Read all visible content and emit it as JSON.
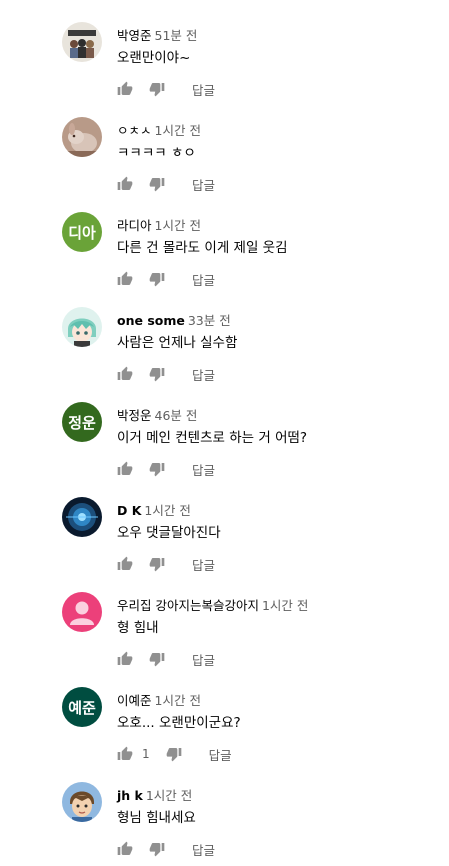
{
  "comments": [
    {
      "author": "박영준",
      "time": "51분 전",
      "text": "오랜만이야~",
      "reply": "답글",
      "avatar": {
        "type": "image",
        "icon": "crowd-poster-avatar"
      },
      "like_count": "",
      "author_bold": false
    },
    {
      "author": "ㅇㅊㅅ",
      "time": "1시간 전",
      "text": "ㅋㅋㅋㅋ ㅎㅇ",
      "reply": "답글",
      "avatar": {
        "type": "image",
        "icon": "rabbit-photo-avatar"
      },
      "like_count": "",
      "author_bold": false
    },
    {
      "author": "라디아",
      "time": "1시간 전",
      "text": "다른 건 몰라도 이게 제일 웃김",
      "reply": "답글",
      "avatar": {
        "type": "initials",
        "initials": "디아",
        "color": "#6aa338"
      },
      "like_count": "",
      "author_bold": false
    },
    {
      "author": "one some",
      "time": "33분 전",
      "text": "사람은 언제나 실수함",
      "reply": "답글",
      "avatar": {
        "type": "image",
        "icon": "anime-character-avatar"
      },
      "like_count": "",
      "author_bold": true
    },
    {
      "author": "박정운",
      "time": "46분 전",
      "text": "이거 메인 컨텐츠로 하는 거 어떰?",
      "reply": "답글",
      "avatar": {
        "type": "initials",
        "initials": "정운",
        "color": "#33691e"
      },
      "like_count": "",
      "author_bold": false
    },
    {
      "author": "D K",
      "time": "1시간 전",
      "text": "오우 댓글달아진다",
      "reply": "답글",
      "avatar": {
        "type": "image",
        "icon": "blue-orb-avatar"
      },
      "like_count": "",
      "author_bold": true
    },
    {
      "author": "우리집 강아지는복슬강아지",
      "time": "1시간 전",
      "text": "형 힘내",
      "reply": "답글",
      "avatar": {
        "type": "image",
        "icon": "default-person-avatar",
        "color": "#ec407a"
      },
      "like_count": "",
      "author_bold": false
    },
    {
      "author": "이예준",
      "time": "1시간 전",
      "text": "오호... 오랜만이군요?",
      "reply": "답글",
      "avatar": {
        "type": "initials",
        "initials": "예준",
        "color": "#004d40"
      },
      "like_count": "1",
      "author_bold": false
    },
    {
      "author": "jh k",
      "time": "1시간 전",
      "text": "형님 힘내세요",
      "reply": "답글",
      "avatar": {
        "type": "image",
        "icon": "cartoon-boy-avatar"
      },
      "like_count": "",
      "author_bold": true
    }
  ]
}
